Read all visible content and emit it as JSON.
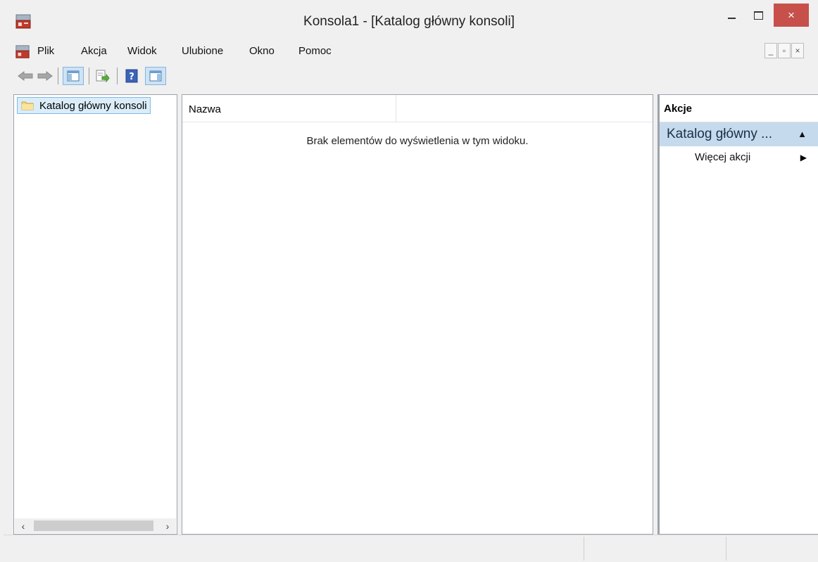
{
  "window": {
    "title": "Konsola1 - [Katalog główny konsoli]",
    "controls": {
      "minimize": "minimize",
      "maximize": "maximize",
      "close": "×"
    }
  },
  "menu": {
    "items": [
      {
        "label": "Plik"
      },
      {
        "label": "Akcja"
      },
      {
        "label": "Widok"
      },
      {
        "label": "Ulubione"
      },
      {
        "label": "Okno"
      },
      {
        "label": "Pomoc"
      }
    ],
    "mdi_controls": [
      "_",
      "▫",
      "×"
    ]
  },
  "toolbar": {
    "buttons": [
      "back-arrow-icon",
      "forward-arrow-icon",
      "show-hide-console-tree-icon",
      "export-list-icon",
      "help-icon",
      "show-hide-action-pane-icon"
    ]
  },
  "tree": {
    "root_label": "Katalog główny konsoli"
  },
  "list": {
    "columns": [
      "Nazwa"
    ],
    "empty_message": "Brak elementów do wyświetlenia w tym widoku."
  },
  "actions_pane": {
    "header": "Akcje",
    "group_title": "Katalog główny ...",
    "items": [
      {
        "label": "Więcej akcji"
      }
    ]
  },
  "colors": {
    "close_button": "#c7504a",
    "group_header": "#c6daee",
    "selection": "#dbedf9"
  }
}
